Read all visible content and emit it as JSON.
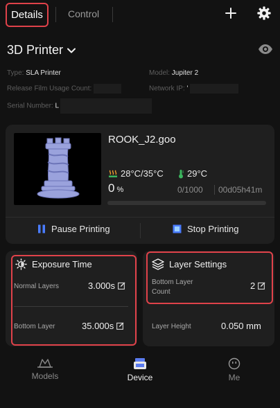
{
  "header": {
    "tab_details": "Details",
    "tab_control": "Control"
  },
  "device": {
    "title": "3D Printer",
    "type_label": "Type:",
    "type_value": "SLA Printer",
    "model_label": "Model:",
    "model_value": "Jupiter 2",
    "film_label": "Release Film Usage Count:",
    "network_label": "Network IP:",
    "network_value": "'",
    "serial_label": "Serial Number:",
    "serial_value": "L"
  },
  "print": {
    "filename": "ROOK_J2.goo",
    "bed_temp": "28°C/35°C",
    "resin_temp": "29°C",
    "percent": "0",
    "percent_unit": "%",
    "layers": "0/1000",
    "elapsed": "00d05h41m",
    "progress": 0,
    "pause_label": "Pause Printing",
    "stop_label": "Stop Printing"
  },
  "exposure": {
    "title": "Exposure Time",
    "normal_label": "Normal Layers",
    "normal_value": "3.000s",
    "bottom_label": "Bottom Layer",
    "bottom_value": "35.000s"
  },
  "layer_settings": {
    "title": "Layer Settings",
    "bottom_count_label_1": "Bottom Layer",
    "bottom_count_label_2": "Count",
    "bottom_count_value": "2",
    "height_label": "Layer Height",
    "height_value": "0.050 mm"
  },
  "nav": {
    "models": "Models",
    "device": "Device",
    "me": "Me"
  },
  "colors": {
    "accent": "#4a7cff",
    "highlight": "#e0424a",
    "background": "#121212",
    "card": "#1f1f1f"
  },
  "icons": [
    "plus-icon",
    "gear-icon",
    "chevron-down-icon",
    "eye-icon",
    "heat-icon",
    "thermometer-icon",
    "pause-icon",
    "stop-icon",
    "sun-icon",
    "layers-icon",
    "edit-icon",
    "models-icon",
    "device-icon",
    "me-icon"
  ]
}
